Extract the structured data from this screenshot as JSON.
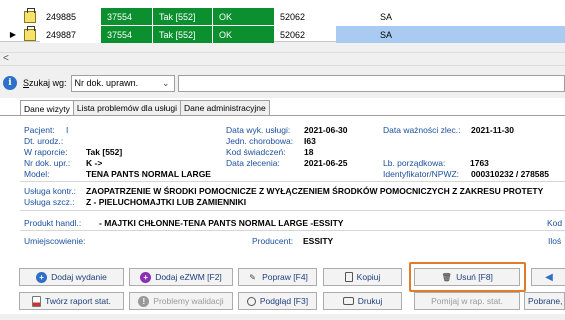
{
  "grid": {
    "rows": [
      {
        "indicator": "",
        "id": "249885",
        "code": "37554",
        "tak": "Tak [552]",
        "status": "OK",
        "num": "52062",
        "sa": "SA"
      },
      {
        "indicator": "▶",
        "id": "249887",
        "code": "37554",
        "tak": "Tak [552]",
        "status": "OK",
        "num": "52062",
        "sa": "SA"
      }
    ]
  },
  "scroll": {
    "left_arrow": "<"
  },
  "search": {
    "icon": "info-icon",
    "label_underlined": "S",
    "label_rest": "zukaj wg:",
    "select_value": "Nr dok. uprawn.",
    "chevron": "⌄",
    "input_value": ""
  },
  "tabs": [
    {
      "label": "Dane wizyty",
      "active": true
    },
    {
      "label": "Lista problemów dla usługi",
      "active": false
    },
    {
      "label": "Dane administracyjne",
      "active": false
    }
  ],
  "fields": {
    "pacjent_lbl": "Pacjent:",
    "pacjent_val": "I",
    "dturodz_lbl": "Dt. urodz.:",
    "wraporcie_lbl": "W raporcie:",
    "wraporcie_val": "Tak [552]",
    "nrdok_lbl": "Nr dok. upr.:",
    "nrdok_val": "K ->",
    "model_lbl": "Model:",
    "model_val": "TENA PANTS NORMAL LARGE",
    "datawyk_lbl": "Data wyk. usługi:",
    "datawyk_val": "2021-06-30",
    "jedn_lbl": "Jedn. chorobowa:",
    "jedn_val": "I63",
    "kod_lbl": "Kod świadczeń:",
    "kod_val": "18",
    "datazl_lbl": "Data zlecenia:",
    "datazl_val": "2021-06-25",
    "datawazn_lbl": "Data ważności zlec.:",
    "datawazn_val": "2021-11-30",
    "lbporz_lbl": "Lb. porządkowa:",
    "lbporz_val": "1763",
    "ident_lbl": "Identyfikator/NPWZ:",
    "ident_val": "000310232 / 278585",
    "uskontr_lbl": "Usługa kontr.:",
    "uskontr_val": "ZAOPATRZENIE W ŚRODKI POMOCNICZE Z WYŁĄCZENIEM ŚRODKÓW POMOCNICZYCH Z ZAKRESU PROTETY",
    "usszcz_lbl": "Usługa szcz.:",
    "usszcz_val": "Z - PIELUCHOMAJTKI LUB ZAMIENNIKI",
    "produkt_lbl": "Produkt handl.:",
    "produkt_val": "- MAJTKI CHŁONNE-TENA PANTS NORMAL LARGE -ESSITY",
    "kod_right": "Kod",
    "umiejsc_lbl": "Umiejscowienie:",
    "producent_lbl": "Producent:",
    "producent_val": "ESSITY",
    "ilosc_right": "Iloś"
  },
  "buttons": {
    "dodaj_wydanie": "Dodaj wydanie",
    "dodaj_ezwm": "Dodaj eZWM [F2]",
    "popraw": "Popraw [F4]",
    "kopiuj": "Kopiuj",
    "usun": "Usuń [F8]",
    "tworz_raport": "Twórz raport stat.",
    "problemy": "Problemy walidacji",
    "podglad": "Podgląd [F3]",
    "drukuj": "Drukuj",
    "pomijaj": "Pomijaj w rap. stat.",
    "pobrane": "Pobrane,"
  },
  "colors": {
    "green": "#0b8f2f",
    "selected_row": "#a9cbf2",
    "highlight": "#e27b2c",
    "label_blue": "#1a4f9e"
  }
}
